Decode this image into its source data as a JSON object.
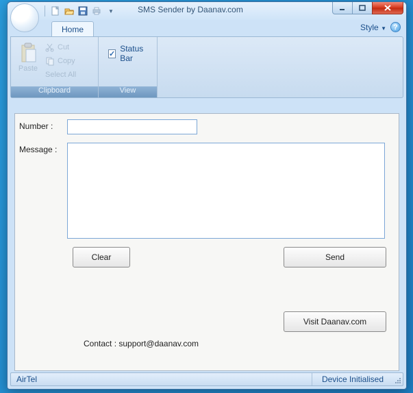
{
  "title": "SMS Sender by Daanav.com",
  "qat": {
    "new": "new-icon",
    "open": "open-icon",
    "save": "save-icon",
    "print": "print-icon"
  },
  "tabs": {
    "home": "Home"
  },
  "style": {
    "label": "Style"
  },
  "ribbon": {
    "clipboard": {
      "label": "Clipboard",
      "paste": "Paste",
      "cut": "Cut",
      "copy": "Copy",
      "selectall": "Select All"
    },
    "view": {
      "label": "View",
      "statusbar": "Status Bar",
      "statusbar_checked": "✓"
    }
  },
  "form": {
    "number_label": "Number :",
    "number_value": "",
    "message_label": "Message :",
    "message_value": "",
    "clear": "Clear",
    "send": "Send",
    "visit": "Visit Daanav.com",
    "contact": "Contact : support@daanav.com"
  },
  "status": {
    "left": "AirTel",
    "right": "Device Initialised"
  }
}
